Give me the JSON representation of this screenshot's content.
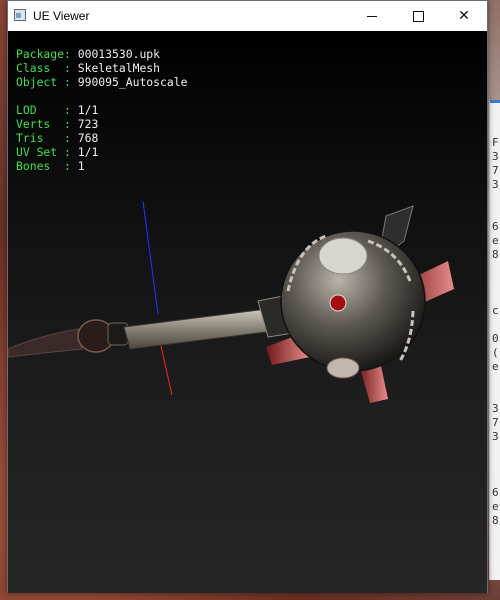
{
  "window": {
    "title": "UE Viewer",
    "minimize_glyph": "",
    "close_glyph": "✕"
  },
  "info": {
    "package_label": "Package: ",
    "package_value": "00013530.upk",
    "class_label": "Class  : ",
    "class_value": "SkeletalMesh",
    "object_label": "Object : ",
    "object_value": "990095_Autoscale",
    "lod_label": "LOD    : ",
    "lod_value": "1/1",
    "verts_label": "Verts  : ",
    "verts_value": "723",
    "tris_label": "Tris   : ",
    "tris_value": "768",
    "uvset_label": "UV Set : ",
    "uvset_value": "1/1",
    "bones_label": "Bones  : ",
    "bones_value": "1"
  },
  "background_window_edge": {
    "chars": [
      "F",
      "3",
      "7",
      "3",
      "6",
      "e",
      "8",
      "c",
      "0",
      "(",
      "e",
      "3",
      "7",
      "3",
      "6",
      "e",
      "8"
    ]
  },
  "colors": {
    "label_green": "#3fe04f",
    "value_white": "#f0f0f0",
    "axis_blue": "#2233ff",
    "axis_red": "#ff2020"
  },
  "icons": {
    "app": "app-window-icon",
    "minimize": "minimize-icon",
    "maximize": "maximize-icon",
    "close": "close-icon"
  }
}
